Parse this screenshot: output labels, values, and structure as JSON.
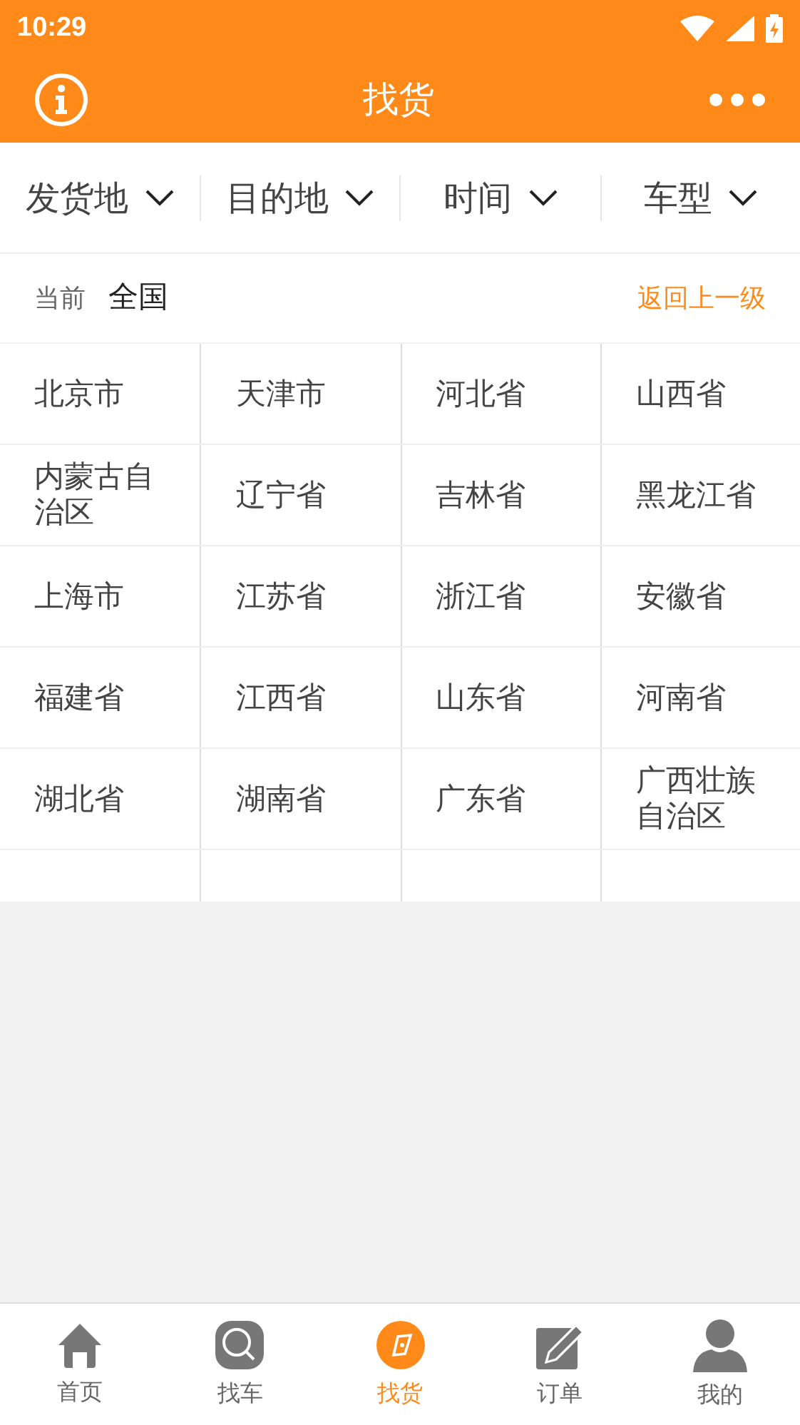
{
  "status_bar": {
    "time": "10:29"
  },
  "header": {
    "title": "找货"
  },
  "filters": [
    {
      "label": "发货地"
    },
    {
      "label": "目的地"
    },
    {
      "label": "时间"
    },
    {
      "label": "车型"
    }
  ],
  "current": {
    "label": "当前",
    "value": "全国",
    "back": "返回上一级"
  },
  "region_rows": [
    [
      "北京市",
      "天津市",
      "河北省",
      "山西省"
    ],
    [
      "内蒙古自治区",
      "辽宁省",
      "吉林省",
      "黑龙江省"
    ],
    [
      "上海市",
      "江苏省",
      "浙江省",
      "安徽省"
    ],
    [
      "福建省",
      "江西省",
      "山东省",
      "河南省"
    ],
    [
      "湖北省",
      "湖南省",
      "广东省",
      "广西壮族自治区"
    ]
  ],
  "tabs": [
    {
      "label": "首页",
      "kind": "home",
      "selected": false
    },
    {
      "label": "找车",
      "kind": "search",
      "selected": false
    },
    {
      "label": "找货",
      "kind": "compass",
      "selected": true
    },
    {
      "label": "订单",
      "kind": "edit",
      "selected": false
    },
    {
      "label": "我的",
      "kind": "user",
      "selected": false
    }
  ]
}
